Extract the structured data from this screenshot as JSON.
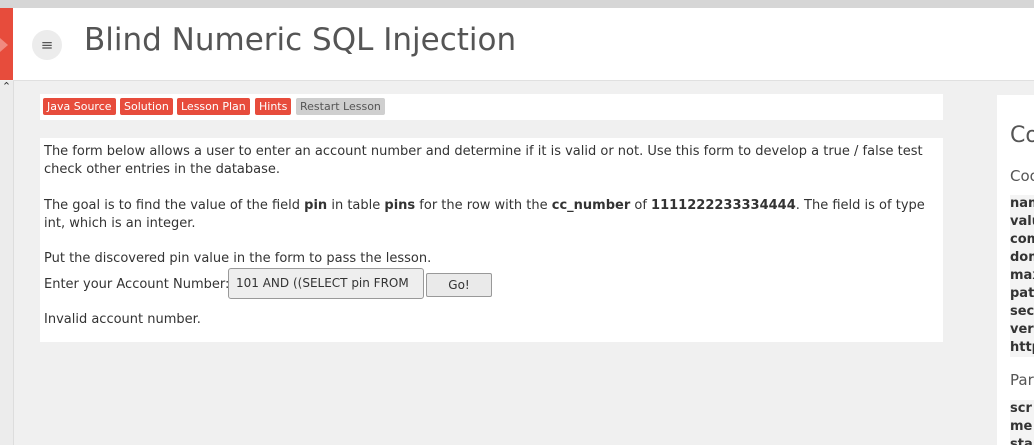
{
  "header": {
    "title": "Blind Numeric SQL Injection",
    "menu_icon": "hamburger-icon"
  },
  "toolbar": {
    "java_source": "Java Source",
    "solution": "Solution",
    "lesson_plan": "Lesson Plan",
    "hints": "Hints",
    "restart": "Restart Lesson"
  },
  "lesson": {
    "para1": "The form below allows a user to enter an account number and determine if it is valid or not. Use this form to develop a true / false test check other entries in the database.",
    "para2_a": "The goal is to find the value of the field ",
    "para2_pin": "pin",
    "para2_b": " in table ",
    "para2_pins": "pins",
    "para2_c": " for the row with the ",
    "para2_cc": "cc_number",
    "para2_d": " of ",
    "para2_num": "1111222233334444",
    "para2_e": ". The field is of type int, which is an integer.",
    "para3": "Put the discovered pin value in the form to pass the lesson.",
    "account_label": "Enter your Account Number:",
    "account_value": "101 AND ((SELECT pin FROM",
    "go_label": "Go!",
    "result": "Invalid account number."
  },
  "right_panel": {
    "heading": "Co",
    "cookies_heading": "Coo",
    "cookie_rows": [
      "nam",
      "valu",
      "com",
      "dom",
      "max",
      "pat",
      "sec",
      "ver",
      "http"
    ],
    "params_heading": "Par",
    "param_rows": [
      "scr",
      "me",
      "sta"
    ]
  },
  "colors": {
    "accent": "#e74c3c",
    "grey_button": "#cfcfcf"
  }
}
